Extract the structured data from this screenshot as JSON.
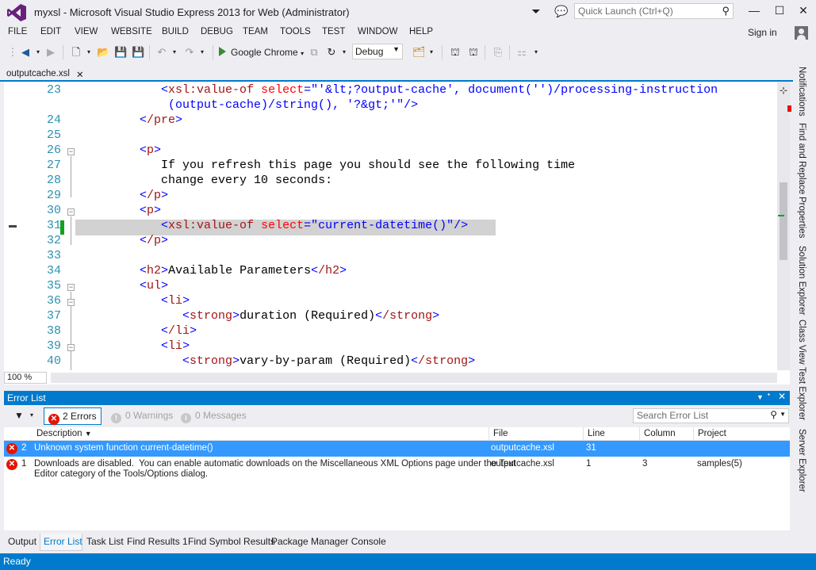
{
  "window": {
    "title": "myxsl - Microsoft Visual Studio Express 2013 for Web (Administrator)",
    "quick_launch_placeholder": "Quick Launch (Ctrl+Q)",
    "accent": "#007acc",
    "logo_color": "#68217a"
  },
  "menu": [
    "FILE",
    "EDIT",
    "VIEW",
    "WEBSITE",
    "BUILD",
    "DEBUG",
    "TEAM",
    "TOOLS",
    "TEST",
    "WINDOW",
    "HELP"
  ],
  "signin": "Sign in",
  "toolbar": {
    "run_target": "Google Chrome",
    "configuration": "Debug"
  },
  "document_tab": {
    "name": "outputcache.xsl"
  },
  "editor": {
    "lines": [
      "23",
      "24",
      "25",
      "26",
      "27",
      "28",
      "29",
      "30",
      "31",
      "32",
      "33",
      "34",
      "35",
      "36",
      "37",
      "38",
      "39",
      "40"
    ],
    "zoom": "100 %",
    "code": {
      "l23a_open": "<",
      "l23a_tag": "xsl:value-of",
      "l23a_attr": " select",
      "l23a_eq": "=\"'&lt;?output-cache', document('')/processing-instruction",
      "l23b": "(output-cache)/string(), '?&gt;'\"/>",
      "l24_tag": "/pre",
      "l26_tag": "p",
      "l27": "If you refresh this page you should see the following time",
      "l28": "change every 10 seconds:",
      "l29_tag": "/p",
      "l30_tag": "p",
      "l31_tag": "xsl:value-of",
      "l31_attr": "select",
      "l31_val": "=\"current-datetime()\"",
      "l32_tag": "/p",
      "l34_tag": "h2",
      "l34_text": "Available Parameters",
      "l34_close": "/h2",
      "l35_tag": "ul",
      "l36_tag": "li",
      "l37_tag": "strong",
      "l37_text": "duration (Required)",
      "l37_close": "/strong",
      "l38_tag": "/li",
      "l39_tag": "li",
      "l40_tag": "strong",
      "l40_text": "vary-by-param (Required)",
      "l40_close": "/strong"
    }
  },
  "right_tabs": [
    "Notifications",
    "Find and Replace",
    "Properties",
    "Solution Explorer",
    "Class View",
    "Test Explorer",
    "Server Explorer"
  ],
  "error_list": {
    "title": "Error List",
    "errors_label": "2 Errors",
    "warnings_label": "0 Warnings",
    "messages_label": "0 Messages",
    "search_placeholder": "Search Error List",
    "columns": [
      "Description",
      "File",
      "Line",
      "Column",
      "Project"
    ],
    "rows": [
      {
        "num": "2",
        "description": "Unknown system function current-datetime()",
        "file": "outputcache.xsl",
        "line": "31",
        "column": "",
        "project": ""
      },
      {
        "num": "1",
        "description": "Downloads are disabled.  You can enable automatic downloads on the Miscellaneous XML Options page under the Text\nEditor category of the Tools/Options dialog.",
        "file": "outputcache.xsl",
        "line": "1",
        "column": "3",
        "project": "samples(5)"
      }
    ]
  },
  "bottom_tabs": [
    "Output",
    "Error List",
    "Task List",
    "Find Results 1",
    "Find Symbol Results",
    "Package Manager Console"
  ],
  "status": "Ready"
}
